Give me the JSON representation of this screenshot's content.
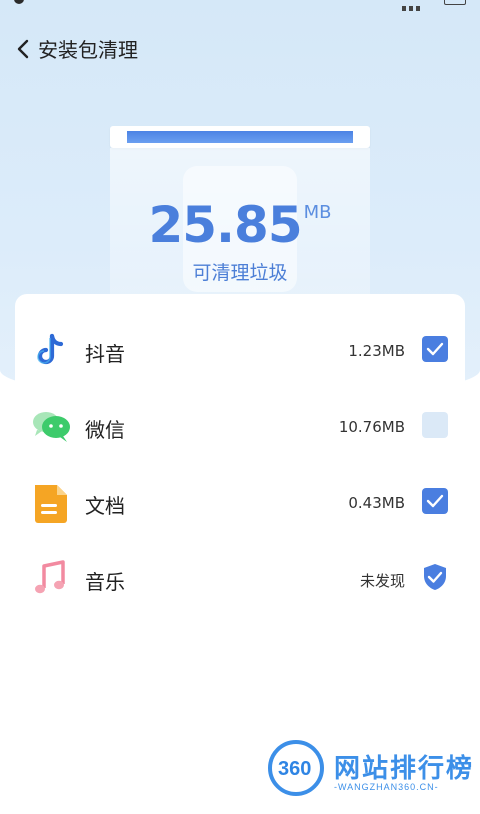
{
  "header": {
    "title": "安装包清理"
  },
  "summary": {
    "size_value": "25.85",
    "size_unit": "MB",
    "label": "可清理垃圾"
  },
  "items": [
    {
      "name": "抖音",
      "size": "1.23MB",
      "checked": true,
      "icon": "tiktok-icon"
    },
    {
      "name": "微信",
      "size": "10.76MB",
      "checked": false,
      "icon": "wechat-icon"
    },
    {
      "name": "文档",
      "size": "0.43MB",
      "checked": true,
      "icon": "document-icon"
    },
    {
      "name": "音乐",
      "size": "未发现",
      "status": "not-found",
      "icon": "music-icon"
    }
  ],
  "watermark": {
    "badge": "360",
    "name": "网站排行榜",
    "url": "-WANGZHAN360.CN-"
  },
  "colors": {
    "accent": "#4a7ee0",
    "unchecked": "#dbe9f7",
    "header_bg": "#d5e8f8"
  }
}
